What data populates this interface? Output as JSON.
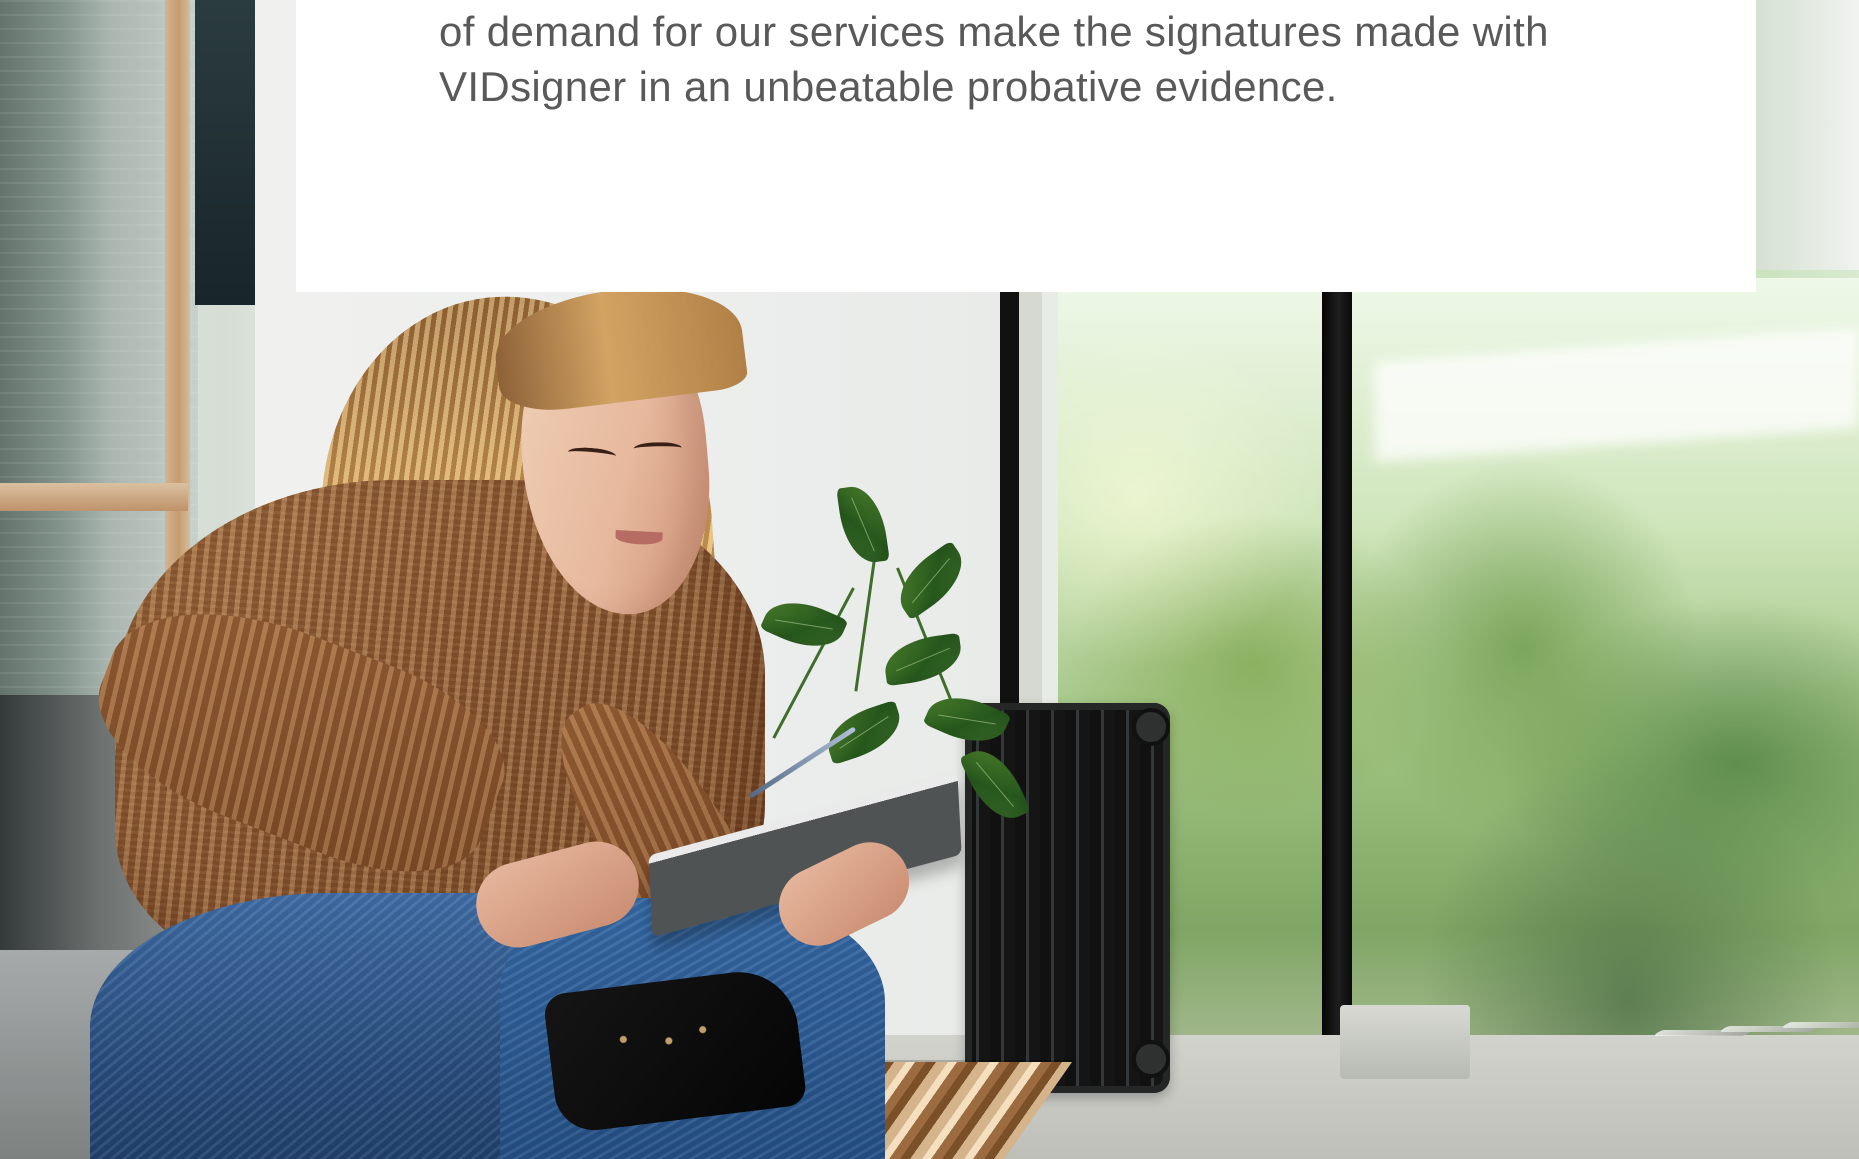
{
  "page": {
    "background_photo": {
      "description": "",
      "colors": {
        "sweater": "#8b5630",
        "jeans": "#284c7c",
        "plant": "#26581d",
        "window_frame": "#111111",
        "garden": "#9dc07e"
      }
    },
    "content_card": {
      "text_line_1": "of demand for our services make the signatures made with",
      "text_line_2": "VIDsigner in an unbeatable probative evidence.",
      "text_color": "#595959",
      "background_color": "#ffffff"
    }
  }
}
